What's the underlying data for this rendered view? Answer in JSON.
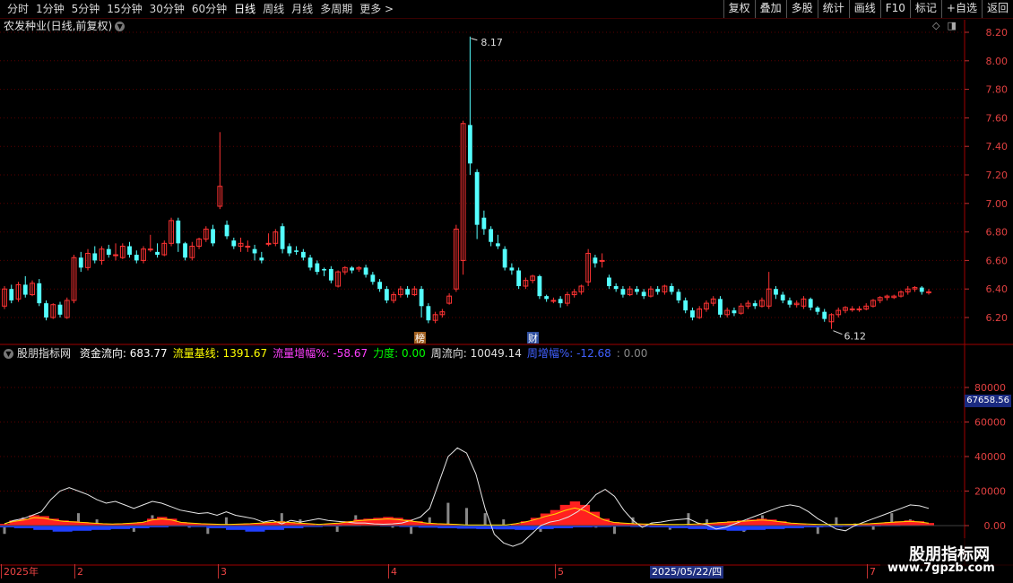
{
  "toolbar": {
    "periods": [
      "分时",
      "1分钟",
      "5分钟",
      "15分钟",
      "30分钟",
      "60分钟",
      "日线",
      "周线",
      "月线",
      "多周期",
      "更多 >"
    ],
    "active_period": "日线",
    "buttons": [
      "复权",
      "叠加",
      "多股",
      "统计",
      "画线",
      "F10",
      "标记",
      "+自选",
      "返回"
    ]
  },
  "stock": {
    "title": "农发种业(日线,前复权)",
    "high_marker": "8.17",
    "low_marker": "6.12",
    "event_tags": [
      "榜",
      "财"
    ]
  },
  "price_axis": [
    "8.20",
    "8.00",
    "7.80",
    "7.60",
    "7.40",
    "7.20",
    "7.00",
    "6.80",
    "6.60",
    "6.40",
    "6.20"
  ],
  "indicator": {
    "name": "股朋指标网",
    "items": [
      {
        "label": "资金流向:",
        "value": "683.77",
        "color": "#ffffff"
      },
      {
        "label": "流量基线:",
        "value": "1391.67",
        "color": "#ffff00"
      },
      {
        "label": "流量增幅%:",
        "value": "-58.67",
        "color": "#ff40ff"
      },
      {
        "label": "力度:",
        "value": "0.00",
        "color": "#00ff00"
      },
      {
        "label": "周流向:",
        "value": "10049.14",
        "color": "#e0e0e0"
      },
      {
        "label": "周增幅%:",
        "value": "-12.68",
        "color": "#4060ff"
      },
      {
        "label": ":",
        "value": "0.00",
        "color": "#888888"
      }
    ],
    "axis": [
      "80000",
      "60000",
      "40000",
      "20000",
      "0.00"
    ],
    "current_value": "67658.56"
  },
  "date_axis": {
    "labels": [
      "2025年",
      "2",
      "3",
      "4",
      "5",
      "7"
    ],
    "highlight": "2025/05/22/四"
  },
  "watermark": {
    "title": "股朋指标网",
    "url": "www.7gpzb.com"
  },
  "colors": {
    "up": "#ff3333",
    "down": "#54ffff",
    "grid": "#5a0000",
    "axis_text": "#e04040"
  },
  "chart_data": {
    "type": "candlestick",
    "ylim": [
      6.1,
      8.25
    ],
    "candles": [
      [
        6.28,
        6.4,
        6.42,
        6.26
      ],
      [
        6.4,
        6.32,
        6.43,
        6.3
      ],
      [
        6.33,
        6.43,
        6.45,
        6.31
      ],
      [
        6.43,
        6.36,
        6.49,
        6.34
      ],
      [
        6.36,
        6.44,
        6.46,
        6.35
      ],
      [
        6.44,
        6.3,
        6.47,
        6.28
      ],
      [
        6.3,
        6.2,
        6.32,
        6.18
      ],
      [
        6.2,
        6.29,
        6.3,
        6.19
      ],
      [
        6.29,
        6.22,
        6.31,
        6.2
      ],
      [
        6.2,
        6.32,
        6.34,
        6.19
      ],
      [
        6.32,
        6.62,
        6.64,
        6.3
      ],
      [
        6.62,
        6.55,
        6.66,
        6.52
      ],
      [
        6.55,
        6.65,
        6.68,
        6.53
      ],
      [
        6.65,
        6.6,
        6.7,
        6.58
      ],
      [
        6.6,
        6.68,
        6.7,
        6.57
      ],
      [
        6.68,
        6.64,
        6.71,
        6.62
      ],
      [
        6.64,
        6.64,
        6.72,
        6.6
      ],
      [
        6.62,
        6.7,
        6.72,
        6.61
      ],
      [
        6.7,
        6.64,
        6.73,
        6.62
      ],
      [
        6.64,
        6.6,
        6.67,
        6.58
      ],
      [
        6.6,
        6.68,
        6.7,
        6.58
      ],
      [
        6.68,
        6.68,
        6.78,
        6.66
      ],
      [
        6.66,
        6.64,
        6.72,
        6.62
      ],
      [
        6.64,
        6.72,
        6.74,
        6.63
      ],
      [
        6.72,
        6.88,
        6.9,
        6.7
      ],
      [
        6.88,
        6.72,
        6.9,
        6.66
      ],
      [
        6.72,
        6.62,
        6.73,
        6.6
      ],
      [
        6.62,
        6.7,
        6.73,
        6.6
      ],
      [
        6.7,
        6.75,
        6.76,
        6.68
      ],
      [
        6.75,
        6.82,
        6.84,
        6.73
      ],
      [
        6.82,
        6.72,
        6.85,
        6.7
      ],
      [
        6.98,
        7.12,
        7.5,
        6.96
      ],
      [
        6.85,
        6.77,
        6.88,
        6.75
      ],
      [
        6.74,
        6.7,
        6.76,
        6.68
      ],
      [
        6.7,
        6.72,
        6.76,
        6.66
      ],
      [
        6.7,
        6.7,
        6.74,
        6.66
      ],
      [
        6.68,
        6.65,
        6.71,
        6.6
      ],
      [
        6.62,
        6.6,
        6.66,
        6.58
      ],
      [
        6.72,
        6.72,
        6.79,
        6.7
      ],
      [
        6.72,
        6.8,
        6.82,
        6.7
      ],
      [
        6.84,
        6.68,
        6.86,
        6.65
      ],
      [
        6.7,
        6.65,
        6.72,
        6.63
      ],
      [
        6.67,
        6.66,
        6.7,
        6.64
      ],
      [
        6.66,
        6.62,
        6.68,
        6.6
      ],
      [
        6.62,
        6.55,
        6.64,
        6.53
      ],
      [
        6.58,
        6.52,
        6.6,
        6.5
      ],
      [
        6.54,
        6.53,
        6.55,
        6.49
      ],
      [
        6.54,
        6.46,
        6.56,
        6.44
      ],
      [
        6.42,
        6.52,
        6.53,
        6.41
      ],
      [
        6.52,
        6.55,
        6.56,
        6.5
      ],
      [
        6.55,
        6.53,
        6.56,
        6.51
      ],
      [
        6.54,
        6.55,
        6.56,
        6.52
      ],
      [
        6.55,
        6.5,
        6.57,
        6.48
      ],
      [
        6.5,
        6.45,
        6.52,
        6.43
      ],
      [
        6.45,
        6.4,
        6.47,
        6.38
      ],
      [
        6.4,
        6.32,
        6.42,
        6.3
      ],
      [
        6.32,
        6.36,
        6.38,
        6.3
      ],
      [
        6.36,
        6.4,
        6.42,
        6.34
      ],
      [
        6.4,
        6.36,
        6.42,
        6.34
      ],
      [
        6.36,
        6.4,
        6.42,
        6.35
      ],
      [
        6.4,
        6.28,
        6.42,
        6.2
      ],
      [
        6.28,
        6.18,
        6.3,
        6.16
      ],
      [
        6.18,
        6.22,
        6.24,
        6.16
      ],
      [
        6.22,
        6.24,
        6.26,
        6.2
      ],
      [
        6.3,
        6.35,
        6.37,
        6.29
      ],
      [
        6.4,
        6.82,
        6.85,
        6.38
      ],
      [
        6.6,
        7.56,
        7.58,
        6.5
      ],
      [
        7.55,
        7.28,
        8.17,
        7.2
      ],
      [
        7.22,
        6.85,
        7.24,
        6.75
      ],
      [
        6.9,
        6.82,
        6.95,
        6.78
      ],
      [
        6.82,
        6.73,
        6.84,
        6.7
      ],
      [
        6.72,
        6.7,
        6.78,
        6.68
      ],
      [
        6.68,
        6.55,
        6.7,
        6.53
      ],
      [
        6.55,
        6.53,
        6.58,
        6.5
      ],
      [
        6.53,
        6.42,
        6.55,
        6.4
      ],
      [
        6.42,
        6.46,
        6.48,
        6.4
      ],
      [
        6.46,
        6.49,
        6.5,
        6.44
      ],
      [
        6.49,
        6.35,
        6.5,
        6.33
      ],
      [
        6.35,
        6.33,
        6.36,
        6.31
      ],
      [
        6.32,
        6.32,
        6.34,
        6.3
      ],
      [
        6.33,
        6.3,
        6.35,
        6.27
      ],
      [
        6.3,
        6.36,
        6.38,
        6.28
      ],
      [
        6.36,
        6.38,
        6.4,
        6.34
      ],
      [
        6.38,
        6.42,
        6.43,
        6.36
      ],
      [
        6.45,
        6.65,
        6.68,
        6.42
      ],
      [
        6.62,
        6.58,
        6.64,
        6.55
      ],
      [
        6.6,
        6.6,
        6.65,
        6.55
      ],
      [
        6.48,
        6.42,
        6.5,
        6.4
      ],
      [
        6.42,
        6.4,
        6.44,
        6.38
      ],
      [
        6.4,
        6.36,
        6.42,
        6.34
      ],
      [
        6.36,
        6.4,
        6.42,
        6.35
      ],
      [
        6.4,
        6.38,
        6.42,
        6.36
      ],
      [
        6.38,
        6.35,
        6.4,
        6.33
      ],
      [
        6.35,
        6.4,
        6.42,
        6.34
      ],
      [
        6.4,
        6.38,
        6.42,
        6.36
      ],
      [
        6.38,
        6.42,
        6.43,
        6.36
      ],
      [
        6.42,
        6.38,
        6.44,
        6.36
      ],
      [
        6.38,
        6.32,
        6.4,
        6.3
      ],
      [
        6.32,
        6.25,
        6.34,
        6.23
      ],
      [
        6.25,
        6.2,
        6.27,
        6.18
      ],
      [
        6.2,
        6.26,
        6.28,
        6.19
      ],
      [
        6.26,
        6.3,
        6.32,
        6.24
      ],
      [
        6.3,
        6.33,
        6.35,
        6.28
      ],
      [
        6.33,
        6.22,
        6.35,
        6.2
      ],
      [
        6.22,
        6.25,
        6.27,
        6.2
      ],
      [
        6.25,
        6.23,
        6.27,
        6.21
      ],
      [
        6.23,
        6.28,
        6.3,
        6.22
      ],
      [
        6.28,
        6.3,
        6.32,
        6.26
      ],
      [
        6.3,
        6.28,
        6.32,
        6.26
      ],
      [
        6.28,
        6.32,
        6.34,
        6.27
      ],
      [
        6.28,
        6.4,
        6.52,
        6.26
      ],
      [
        6.4,
        6.36,
        6.42,
        6.33
      ],
      [
        6.36,
        6.32,
        6.38,
        6.3
      ],
      [
        6.32,
        6.29,
        6.34,
        6.27
      ],
      [
        6.29,
        6.3,
        6.32,
        6.27
      ],
      [
        6.28,
        6.33,
        6.35,
        6.26
      ],
      [
        6.33,
        6.27,
        6.34,
        6.25
      ],
      [
        6.27,
        6.24,
        6.28,
        6.22
      ],
      [
        6.24,
        6.19,
        6.26,
        6.17
      ],
      [
        6.17,
        6.22,
        6.23,
        6.12
      ],
      [
        6.22,
        6.25,
        6.27,
        6.2
      ],
      [
        6.25,
        6.27,
        6.28,
        6.23
      ],
      [
        6.26,
        6.26,
        6.28,
        6.24
      ],
      [
        6.26,
        6.26,
        6.28,
        6.24
      ],
      [
        6.26,
        6.28,
        6.3,
        6.25
      ],
      [
        6.28,
        6.32,
        6.33,
        6.27
      ],
      [
        6.32,
        6.34,
        6.35,
        6.3
      ],
      [
        6.34,
        6.35,
        6.36,
        6.32
      ],
      [
        6.34,
        6.35,
        6.36,
        6.33
      ],
      [
        6.35,
        6.38,
        6.39,
        6.34
      ],
      [
        6.38,
        6.4,
        6.42,
        6.36
      ],
      [
        6.4,
        6.41,
        6.42,
        6.38
      ],
      [
        6.41,
        6.38,
        6.42,
        6.36
      ],
      [
        6.38,
        6.38,
        6.4,
        6.36
      ]
    ],
    "indicator_series": {
      "fund_flow": [
        1000,
        3000,
        4000,
        6000,
        8000,
        15000,
        20000,
        22000,
        20000,
        18000,
        15000,
        13000,
        14000,
        12000,
        10000,
        12000,
        14000,
        13000,
        11000,
        9000,
        8000,
        7000,
        7500,
        6000,
        8000,
        6000,
        5000,
        4000,
        2000,
        3000,
        1000,
        3000,
        2000,
        3000,
        4000,
        3000,
        2500,
        2000,
        1500,
        1500,
        1000,
        800,
        1000,
        1500,
        3000,
        5000,
        10000,
        25000,
        40000,
        45000,
        42000,
        30000,
        10000,
        -5000,
        -10000,
        -12000,
        -10000,
        -5000,
        0,
        2000,
        3000,
        5000,
        8000,
        12000,
        18000,
        21000,
        17000,
        9000,
        3000,
        -1000,
        1500,
        2000,
        3000,
        3500,
        4000,
        1500,
        500,
        -2000,
        -1000,
        1000,
        3000,
        5000,
        7000,
        9000,
        11000,
        12000,
        11000,
        8000,
        4000,
        1000,
        -2000,
        -3000,
        0,
        2000,
        4000,
        6000,
        8000,
        10000,
        12000,
        11500,
        10000
      ],
      "red_bars": [
        1000,
        3000,
        4000,
        6000,
        5500,
        4000,
        3000,
        2500,
        2000,
        1500,
        1000,
        800,
        1000,
        1500,
        2000,
        4000,
        5000,
        4000,
        2000,
        1500,
        1000,
        800,
        500,
        500,
        800,
        1000,
        1500,
        2000,
        2500,
        2000,
        1500,
        1000,
        500,
        1000,
        1500,
        2500,
        3500,
        4000,
        4500,
        5000,
        4500,
        3500,
        2500,
        1500,
        1000,
        800,
        500,
        0,
        0,
        0,
        0,
        0,
        1000,
        2500,
        4500,
        7000,
        9000,
        12000,
        14000,
        12000,
        8000,
        4000,
        2000,
        1500,
        1000,
        800,
        600,
        500,
        400,
        300,
        600,
        1000,
        1500,
        2000,
        2500,
        3000,
        3500,
        4000,
        3500,
        2500,
        1500,
        1000,
        600,
        400,
        300,
        400,
        500,
        700,
        1000,
        1500,
        2000,
        2500,
        3000,
        2500,
        1500
      ],
      "blue_bars": [
        -1000,
        -1500,
        -2500,
        -3500,
        -3000,
        -2500,
        -2000,
        -1500,
        -1000,
        -500,
        -800,
        -1500,
        -2500,
        -3500,
        -2500,
        -1500,
        -800,
        -500,
        -400,
        -300,
        -500,
        -800,
        -1200,
        -1500,
        -1800,
        -2000,
        -2200,
        -2500,
        -2000,
        -1500,
        -1000,
        -800,
        -600,
        -800,
        -1000,
        -1500,
        -2000,
        -2500,
        -3000,
        -2500,
        -2000,
        -1500,
        -1000,
        -800,
        -600,
        -500,
        -400,
        -300,
        -200
      ]
    }
  }
}
